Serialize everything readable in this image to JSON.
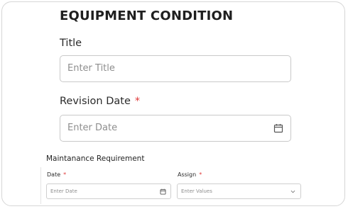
{
  "form": {
    "section_title": "EQUIPMENT CONDITION",
    "title_label": "Title",
    "title_placeholder": "Enter Title",
    "revision_label": "Revision Date",
    "revision_required": "*",
    "revision_placeholder": "Enter Date"
  },
  "maintenance": {
    "heading": "Maintanance Requirement",
    "date_label": "Date",
    "date_required": "*",
    "date_placeholder": "Enter Date",
    "assign_label": "Assign",
    "assign_required": "*",
    "assign_placeholder": "Enter Values"
  },
  "icons": {
    "calendar": "calendar-icon",
    "dropdown": "chevron-down-icon"
  },
  "colors": {
    "required": "#e03a3a",
    "border": "#c9c9c9",
    "placeholder": "#8e8e8e"
  }
}
